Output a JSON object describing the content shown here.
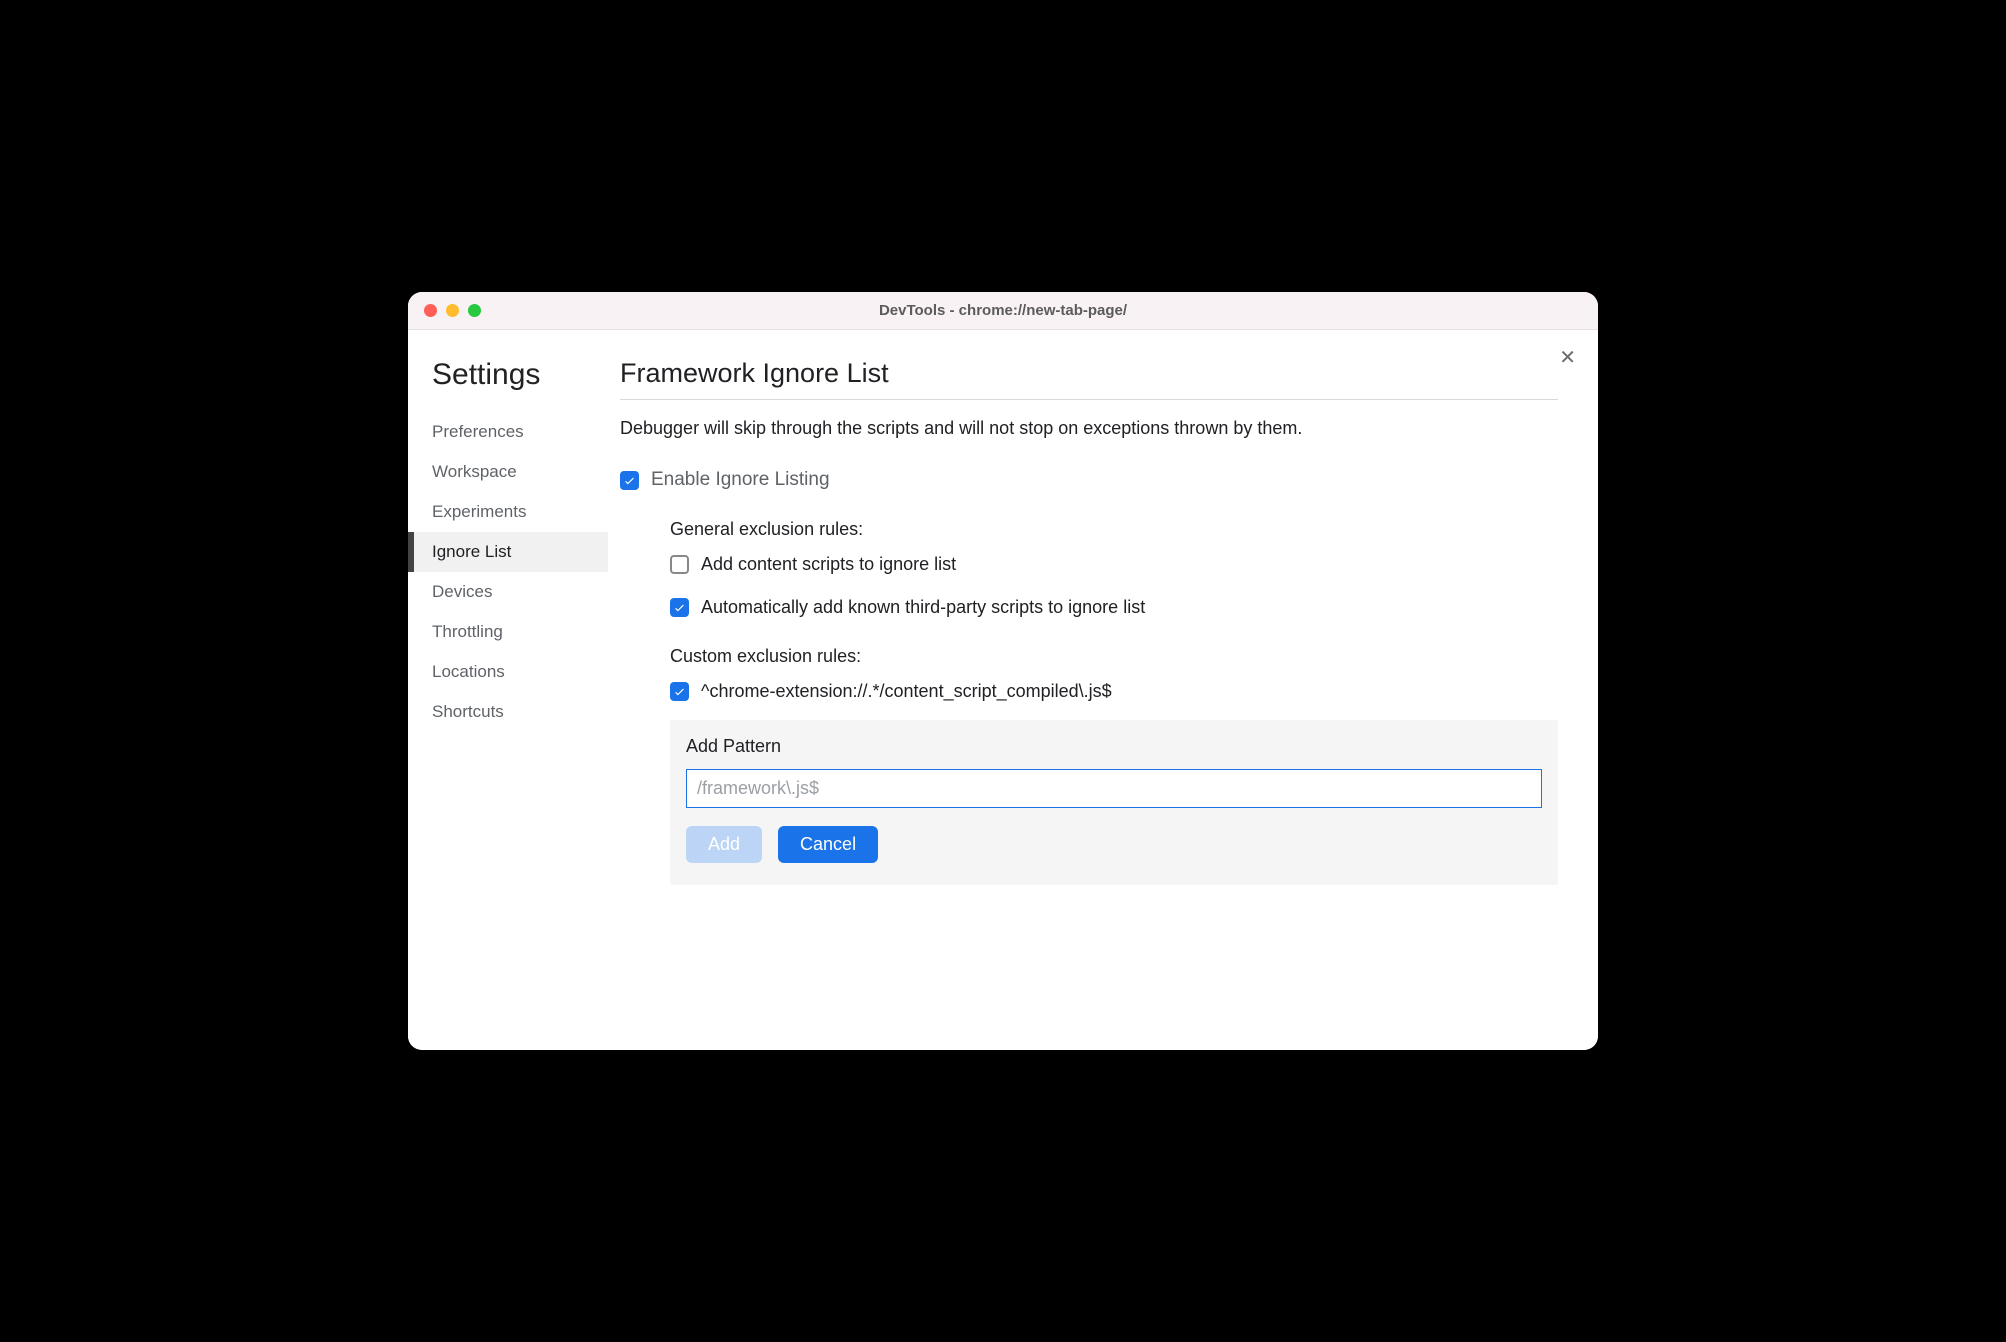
{
  "window": {
    "title": "DevTools - chrome://new-tab-page/"
  },
  "sidebar": {
    "heading": "Settings",
    "items": [
      {
        "label": "Preferences",
        "active": false
      },
      {
        "label": "Workspace",
        "active": false
      },
      {
        "label": "Experiments",
        "active": false
      },
      {
        "label": "Ignore List",
        "active": true
      },
      {
        "label": "Devices",
        "active": false
      },
      {
        "label": "Throttling",
        "active": false
      },
      {
        "label": "Locations",
        "active": false
      },
      {
        "label": "Shortcuts",
        "active": false
      }
    ]
  },
  "main": {
    "title": "Framework Ignore List",
    "description": "Debugger will skip through the scripts and will not stop on exceptions thrown by them.",
    "enable_label": "Enable Ignore Listing",
    "enable_checked": true,
    "general_rules_heading": "General exclusion rules:",
    "general_rules": [
      {
        "label": "Add content scripts to ignore list",
        "checked": false
      },
      {
        "label": "Automatically add known third-party scripts to ignore list",
        "checked": true
      }
    ],
    "custom_rules_heading": "Custom exclusion rules:",
    "custom_rules": [
      {
        "label": "^chrome-extension://.*/content_script_compiled\\.js$",
        "checked": true
      }
    ],
    "add_pattern": {
      "title": "Add Pattern",
      "placeholder": "/framework\\.js$",
      "value": "",
      "add_label": "Add",
      "cancel_label": "Cancel"
    }
  },
  "close_glyph": "✕"
}
